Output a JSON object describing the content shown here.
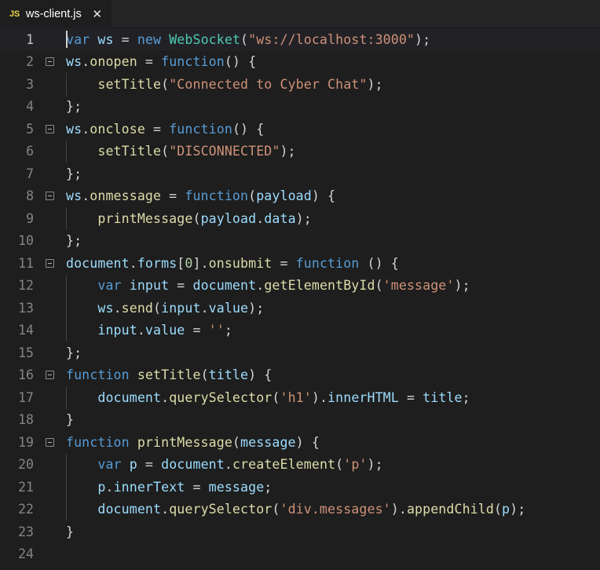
{
  "window": {
    "app": "vscode-editor",
    "background": "#1e1e1e"
  },
  "tabbar": {
    "tabs": [
      {
        "icon_label": "JS",
        "icon_name": "javascript-file-icon",
        "icon_color": "#e9d44b",
        "label": "ws-client.js",
        "close_glyph": "✕",
        "active": true
      }
    ]
  },
  "theme": {
    "editor_background": "#1e1e1e",
    "tabbar_background": "#252526",
    "active_line_background": "#222226",
    "line_number_color": "#858585",
    "active_line_number_color": "#c6c6c6",
    "indent_guide_color": "#404040",
    "keyword": "#569cd6",
    "variable": "#9cdcfe",
    "class": "#4ec9b0",
    "function": "#dcdcaa",
    "string": "#ce9178",
    "number": "#b5cea8",
    "punctuation": "#d4d4d4"
  },
  "editor": {
    "language": "javascript",
    "total_lines": 24,
    "active_line": 1,
    "cursor": {
      "line": 1,
      "column": 1
    },
    "lines": [
      {
        "n": "1",
        "fold": false,
        "guide": false,
        "active": true,
        "tokens": [
          {
            "t": "var",
            "c": "kw"
          },
          {
            "t": " ",
            "c": "op"
          },
          {
            "t": "ws",
            "c": "var"
          },
          {
            "t": " ",
            "c": "op"
          },
          {
            "t": "=",
            "c": "op"
          },
          {
            "t": " ",
            "c": "op"
          },
          {
            "t": "new",
            "c": "kw"
          },
          {
            "t": " ",
            "c": "op"
          },
          {
            "t": "WebSocket",
            "c": "cls"
          },
          {
            "t": "(",
            "c": "op"
          },
          {
            "t": "\"ws://localhost:3000\"",
            "c": "str"
          },
          {
            "t": ");",
            "c": "op"
          }
        ]
      },
      {
        "n": "2",
        "fold": true,
        "guide": false,
        "active": false,
        "tokens": [
          {
            "t": "ws",
            "c": "var"
          },
          {
            "t": ".",
            "c": "op"
          },
          {
            "t": "onopen",
            "c": "fn"
          },
          {
            "t": " = ",
            "c": "op"
          },
          {
            "t": "function",
            "c": "kw"
          },
          {
            "t": "() {",
            "c": "op"
          }
        ]
      },
      {
        "n": "3",
        "fold": false,
        "guide": true,
        "active": false,
        "tokens": [
          {
            "t": "    ",
            "c": "op"
          },
          {
            "t": "setTitle",
            "c": "fn"
          },
          {
            "t": "(",
            "c": "op"
          },
          {
            "t": "\"Connected to Cyber Chat\"",
            "c": "str"
          },
          {
            "t": ");",
            "c": "op"
          }
        ]
      },
      {
        "n": "4",
        "fold": false,
        "guide": false,
        "active": false,
        "tokens": [
          {
            "t": "};",
            "c": "op"
          }
        ]
      },
      {
        "n": "5",
        "fold": true,
        "guide": false,
        "active": false,
        "tokens": [
          {
            "t": "ws",
            "c": "var"
          },
          {
            "t": ".",
            "c": "op"
          },
          {
            "t": "onclose",
            "c": "fn"
          },
          {
            "t": " = ",
            "c": "op"
          },
          {
            "t": "function",
            "c": "kw"
          },
          {
            "t": "() {",
            "c": "op"
          }
        ]
      },
      {
        "n": "6",
        "fold": false,
        "guide": true,
        "active": false,
        "tokens": [
          {
            "t": "    ",
            "c": "op"
          },
          {
            "t": "setTitle",
            "c": "fn"
          },
          {
            "t": "(",
            "c": "op"
          },
          {
            "t": "\"DISCONNECTED\"",
            "c": "str"
          },
          {
            "t": ");",
            "c": "op"
          }
        ]
      },
      {
        "n": "7",
        "fold": false,
        "guide": false,
        "active": false,
        "tokens": [
          {
            "t": "};",
            "c": "op"
          }
        ]
      },
      {
        "n": "8",
        "fold": true,
        "guide": false,
        "active": false,
        "tokens": [
          {
            "t": "ws",
            "c": "var"
          },
          {
            "t": ".",
            "c": "op"
          },
          {
            "t": "onmessage",
            "c": "fn"
          },
          {
            "t": " = ",
            "c": "op"
          },
          {
            "t": "function",
            "c": "kw"
          },
          {
            "t": "(",
            "c": "op"
          },
          {
            "t": "payload",
            "c": "var"
          },
          {
            "t": ") {",
            "c": "op"
          }
        ]
      },
      {
        "n": "9",
        "fold": false,
        "guide": true,
        "active": false,
        "tokens": [
          {
            "t": "    ",
            "c": "op"
          },
          {
            "t": "printMessage",
            "c": "fn"
          },
          {
            "t": "(",
            "c": "op"
          },
          {
            "t": "payload",
            "c": "var"
          },
          {
            "t": ".",
            "c": "op"
          },
          {
            "t": "data",
            "c": "var"
          },
          {
            "t": ");",
            "c": "op"
          }
        ]
      },
      {
        "n": "10",
        "fold": false,
        "guide": false,
        "active": false,
        "tokens": [
          {
            "t": "};",
            "c": "op"
          }
        ]
      },
      {
        "n": "11",
        "fold": true,
        "guide": false,
        "active": false,
        "tokens": [
          {
            "t": "document",
            "c": "var"
          },
          {
            "t": ".",
            "c": "op"
          },
          {
            "t": "forms",
            "c": "var"
          },
          {
            "t": "[",
            "c": "op"
          },
          {
            "t": "0",
            "c": "num"
          },
          {
            "t": "]",
            "c": "op"
          },
          {
            "t": ".",
            "c": "op"
          },
          {
            "t": "onsubmit",
            "c": "fn"
          },
          {
            "t": " = ",
            "c": "op"
          },
          {
            "t": "function",
            "c": "kw"
          },
          {
            "t": " () {",
            "c": "op"
          }
        ]
      },
      {
        "n": "12",
        "fold": false,
        "guide": true,
        "active": false,
        "tokens": [
          {
            "t": "    ",
            "c": "op"
          },
          {
            "t": "var",
            "c": "kw"
          },
          {
            "t": " ",
            "c": "op"
          },
          {
            "t": "input",
            "c": "var"
          },
          {
            "t": " = ",
            "c": "op"
          },
          {
            "t": "document",
            "c": "var"
          },
          {
            "t": ".",
            "c": "op"
          },
          {
            "t": "getElementById",
            "c": "fn"
          },
          {
            "t": "(",
            "c": "op"
          },
          {
            "t": "'message'",
            "c": "str"
          },
          {
            "t": ");",
            "c": "op"
          }
        ]
      },
      {
        "n": "13",
        "fold": false,
        "guide": true,
        "active": false,
        "tokens": [
          {
            "t": "    ",
            "c": "op"
          },
          {
            "t": "ws",
            "c": "var"
          },
          {
            "t": ".",
            "c": "op"
          },
          {
            "t": "send",
            "c": "fn"
          },
          {
            "t": "(",
            "c": "op"
          },
          {
            "t": "input",
            "c": "var"
          },
          {
            "t": ".",
            "c": "op"
          },
          {
            "t": "value",
            "c": "var"
          },
          {
            "t": ");",
            "c": "op"
          }
        ]
      },
      {
        "n": "14",
        "fold": false,
        "guide": true,
        "active": false,
        "tokens": [
          {
            "t": "    ",
            "c": "op"
          },
          {
            "t": "input",
            "c": "var"
          },
          {
            "t": ".",
            "c": "op"
          },
          {
            "t": "value",
            "c": "var"
          },
          {
            "t": " = ",
            "c": "op"
          },
          {
            "t": "''",
            "c": "str"
          },
          {
            "t": ";",
            "c": "op"
          }
        ]
      },
      {
        "n": "15",
        "fold": false,
        "guide": false,
        "active": false,
        "tokens": [
          {
            "t": "};",
            "c": "op"
          }
        ]
      },
      {
        "n": "16",
        "fold": true,
        "guide": false,
        "active": false,
        "tokens": [
          {
            "t": "function",
            "c": "kw"
          },
          {
            "t": " ",
            "c": "op"
          },
          {
            "t": "setTitle",
            "c": "fn"
          },
          {
            "t": "(",
            "c": "op"
          },
          {
            "t": "title",
            "c": "var"
          },
          {
            "t": ") {",
            "c": "op"
          }
        ]
      },
      {
        "n": "17",
        "fold": false,
        "guide": true,
        "active": false,
        "tokens": [
          {
            "t": "    ",
            "c": "op"
          },
          {
            "t": "document",
            "c": "var"
          },
          {
            "t": ".",
            "c": "op"
          },
          {
            "t": "querySelector",
            "c": "fn"
          },
          {
            "t": "(",
            "c": "op"
          },
          {
            "t": "'h1'",
            "c": "str"
          },
          {
            "t": ").",
            "c": "op"
          },
          {
            "t": "innerHTML",
            "c": "var"
          },
          {
            "t": " = ",
            "c": "op"
          },
          {
            "t": "title",
            "c": "var"
          },
          {
            "t": ";",
            "c": "op"
          }
        ]
      },
      {
        "n": "18",
        "fold": false,
        "guide": false,
        "active": false,
        "tokens": [
          {
            "t": "}",
            "c": "op"
          }
        ]
      },
      {
        "n": "19",
        "fold": true,
        "guide": false,
        "active": false,
        "tokens": [
          {
            "t": "function",
            "c": "kw"
          },
          {
            "t": " ",
            "c": "op"
          },
          {
            "t": "printMessage",
            "c": "fn"
          },
          {
            "t": "(",
            "c": "op"
          },
          {
            "t": "message",
            "c": "var"
          },
          {
            "t": ") {",
            "c": "op"
          }
        ]
      },
      {
        "n": "20",
        "fold": false,
        "guide": true,
        "active": false,
        "tokens": [
          {
            "t": "    ",
            "c": "op"
          },
          {
            "t": "var",
            "c": "kw"
          },
          {
            "t": " ",
            "c": "op"
          },
          {
            "t": "p",
            "c": "var"
          },
          {
            "t": " = ",
            "c": "op"
          },
          {
            "t": "document",
            "c": "var"
          },
          {
            "t": ".",
            "c": "op"
          },
          {
            "t": "createElement",
            "c": "fn"
          },
          {
            "t": "(",
            "c": "op"
          },
          {
            "t": "'p'",
            "c": "str"
          },
          {
            "t": ");",
            "c": "op"
          }
        ]
      },
      {
        "n": "21",
        "fold": false,
        "guide": true,
        "active": false,
        "tokens": [
          {
            "t": "    ",
            "c": "op"
          },
          {
            "t": "p",
            "c": "var"
          },
          {
            "t": ".",
            "c": "op"
          },
          {
            "t": "innerText",
            "c": "var"
          },
          {
            "t": " = ",
            "c": "op"
          },
          {
            "t": "message",
            "c": "var"
          },
          {
            "t": ";",
            "c": "op"
          }
        ]
      },
      {
        "n": "22",
        "fold": false,
        "guide": true,
        "active": false,
        "tokens": [
          {
            "t": "    ",
            "c": "op"
          },
          {
            "t": "document",
            "c": "var"
          },
          {
            "t": ".",
            "c": "op"
          },
          {
            "t": "querySelector",
            "c": "fn"
          },
          {
            "t": "(",
            "c": "op"
          },
          {
            "t": "'div.messages'",
            "c": "str"
          },
          {
            "t": ").",
            "c": "op"
          },
          {
            "t": "appendChild",
            "c": "fn"
          },
          {
            "t": "(",
            "c": "op"
          },
          {
            "t": "p",
            "c": "var"
          },
          {
            "t": ");",
            "c": "op"
          }
        ]
      },
      {
        "n": "23",
        "fold": false,
        "guide": false,
        "active": false,
        "tokens": [
          {
            "t": "}",
            "c": "op"
          }
        ]
      },
      {
        "n": "24",
        "fold": false,
        "guide": false,
        "active": false,
        "tokens": []
      }
    ]
  }
}
